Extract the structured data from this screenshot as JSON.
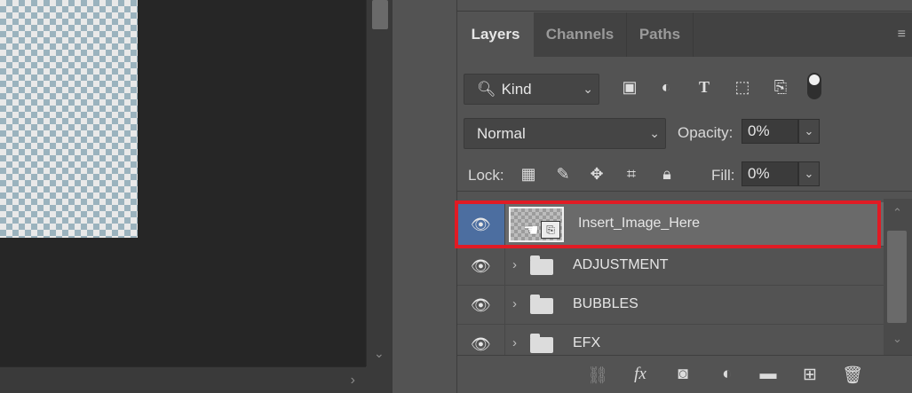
{
  "tabs": [
    {
      "label": "Layers",
      "active": true
    },
    {
      "label": "Channels",
      "active": false
    },
    {
      "label": "Paths",
      "active": false
    }
  ],
  "filter": {
    "kind_label": "Kind",
    "icons": [
      "image-filter-icon",
      "adjustment-filter-icon",
      "type-filter-icon",
      "shape-filter-icon",
      "smart-object-filter-icon",
      "filter-toggle"
    ]
  },
  "blend": {
    "mode": "Normal",
    "opacity_label": "Opacity:",
    "opacity_value": "0%",
    "fill_label": "Fill:",
    "fill_value": "0%"
  },
  "lock": {
    "label": "Lock:",
    "icons": [
      "lock-transparent-pixels-icon",
      "lock-image-pixels-icon",
      "lock-position-icon",
      "lock-artboard-icon",
      "lock-all-icon"
    ]
  },
  "layers": [
    {
      "name": "Insert_Image_Here",
      "type": "smart-object",
      "visible": true,
      "selected": true
    },
    {
      "name": "ADJUSTMENT",
      "type": "group",
      "visible": true,
      "selected": false
    },
    {
      "name": "BUBBLES",
      "type": "group",
      "visible": true,
      "selected": false
    },
    {
      "name": "EFX",
      "type": "group",
      "visible": true,
      "selected": false
    }
  ],
  "bottom_icons": [
    "link-layers-icon",
    "layer-style-icon",
    "add-mask-icon",
    "new-fill-adjustment-icon",
    "new-group-icon",
    "new-layer-icon",
    "delete-layer-icon"
  ],
  "colors": {
    "selected_eye_cell": "#4c6ea0",
    "highlight_border": "#e01b24",
    "panel_bg": "#535353"
  }
}
